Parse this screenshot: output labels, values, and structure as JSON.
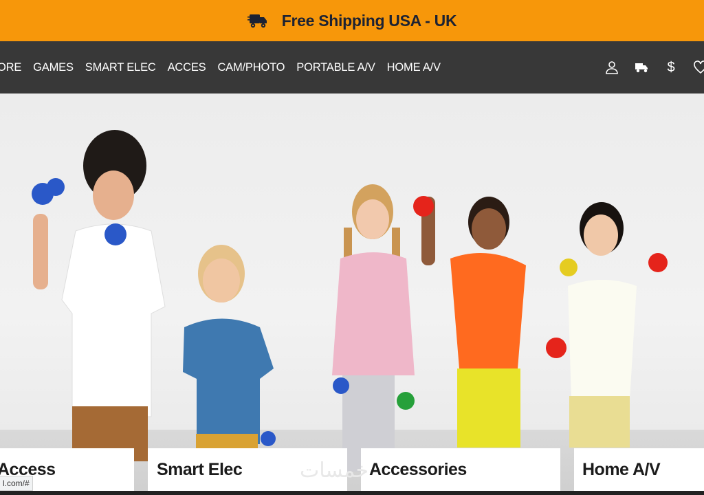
{
  "banner": {
    "text": "Free Shipping USA - UK",
    "icon": "delivery-truck-icon"
  },
  "nav": {
    "items": [
      "ORE",
      "GAMES",
      "SMART ELEC",
      "ACCES",
      "CAM/PHOTO",
      "PORTABLE A/V",
      "HOME A/V"
    ],
    "icons": [
      "user-icon",
      "truck-icon",
      "dollar-icon",
      "heart-icon"
    ],
    "currency_symbol": "$"
  },
  "hero": {
    "image": "children-holding-colored-balls"
  },
  "cards": [
    "Access",
    "Smart Elec",
    "Accessories",
    "Home A/V"
  ],
  "status_url": "l.com/#",
  "watermark": "خمسات",
  "colors": {
    "banner": "#f7970a",
    "nav": "#383838",
    "banner_text": "#1c2233"
  }
}
